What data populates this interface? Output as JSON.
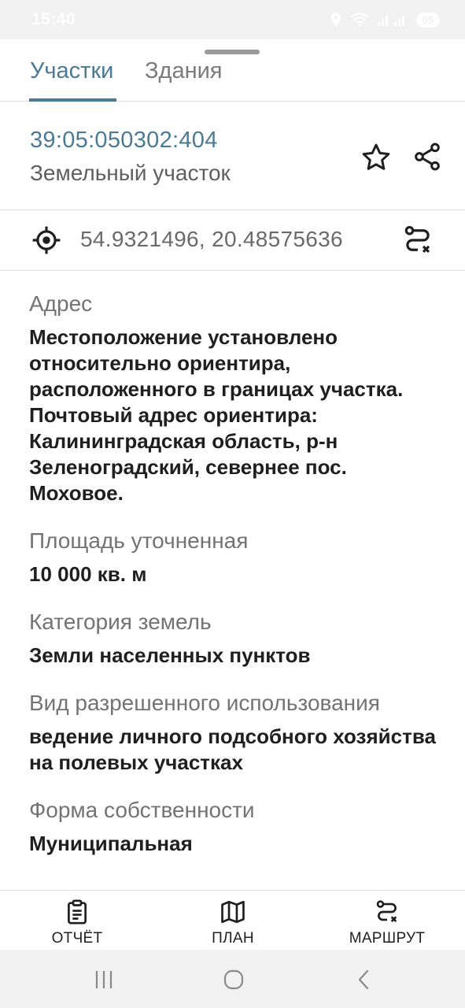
{
  "status_bar": {
    "time": "15:40",
    "battery": "65"
  },
  "tabs": [
    {
      "label": "Участки",
      "active": true
    },
    {
      "label": "Здания",
      "active": false
    }
  ],
  "parcel": {
    "cadastral_number": "39:05:050302:404",
    "type": "Земельный участок"
  },
  "location": {
    "coordinates": "54.9321496, 20.48575636"
  },
  "details": {
    "address": {
      "label": "Адрес",
      "lines": [
        "Местоположение установлено",
        "относительно ориентира,",
        "расположенного в границах участка.",
        "Почтовый адрес ориентира:",
        "Калининградская область, р-н",
        "Зеленоградский, севернее пос.",
        "Моховое."
      ]
    },
    "area": {
      "label": "Площадь уточненная",
      "value": "10 000 кв. м"
    },
    "category": {
      "label": "Категория земель",
      "value": "Земли населенных пунктов"
    },
    "permitted_use": {
      "label": "Вид разрешенного использования",
      "lines": [
        "ведение личного подсобного хозяйства",
        "на полевых участках"
      ]
    },
    "ownership": {
      "label": "Форма собственности",
      "value": "Муниципальная"
    }
  },
  "bottom_nav": [
    {
      "label": "ОТЧЁТ",
      "icon": "clipboard-report-icon"
    },
    {
      "label": "ПЛАН",
      "icon": "map-icon"
    },
    {
      "label": "МАРШРУТ",
      "icon": "route-icon"
    }
  ],
  "colors": {
    "accent": "#4a7a95",
    "text": "#1f1f1f",
    "muted": "#737373",
    "divider": "#e0e0e0"
  }
}
